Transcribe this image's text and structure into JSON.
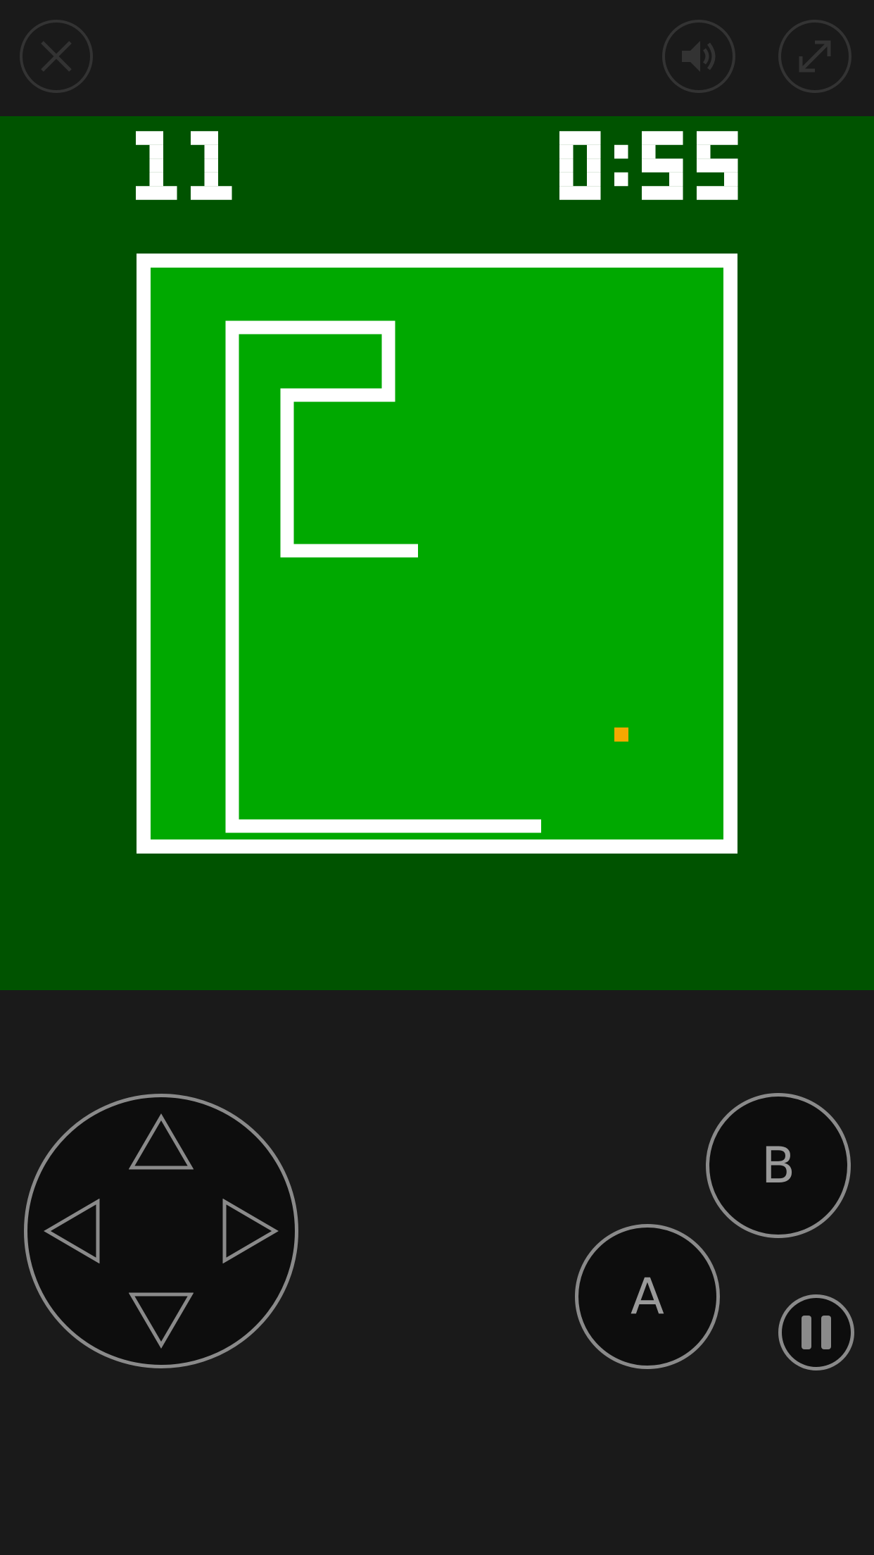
{
  "top_bar": {
    "close_icon": "close-icon",
    "sound_icon": "speaker-icon",
    "fullscreen_icon": "expand-icon",
    "icon_color": "#333333"
  },
  "game": {
    "score": "11",
    "timer": "0:55",
    "background_color": "#005300",
    "field_color": "#00a900",
    "wall_color": "#ffffff",
    "snake_color": "#ffffff",
    "food_color": "#f5a800"
  },
  "controls": {
    "dpad_up_icon": "triangle-up-icon",
    "dpad_down_icon": "triangle-down-icon",
    "dpad_left_icon": "triangle-left-icon",
    "dpad_right_icon": "triangle-right-icon",
    "button_a_label": "A",
    "button_b_label": "B",
    "pause_icon": "pause-icon",
    "outline_color": "#8a8a8a"
  }
}
